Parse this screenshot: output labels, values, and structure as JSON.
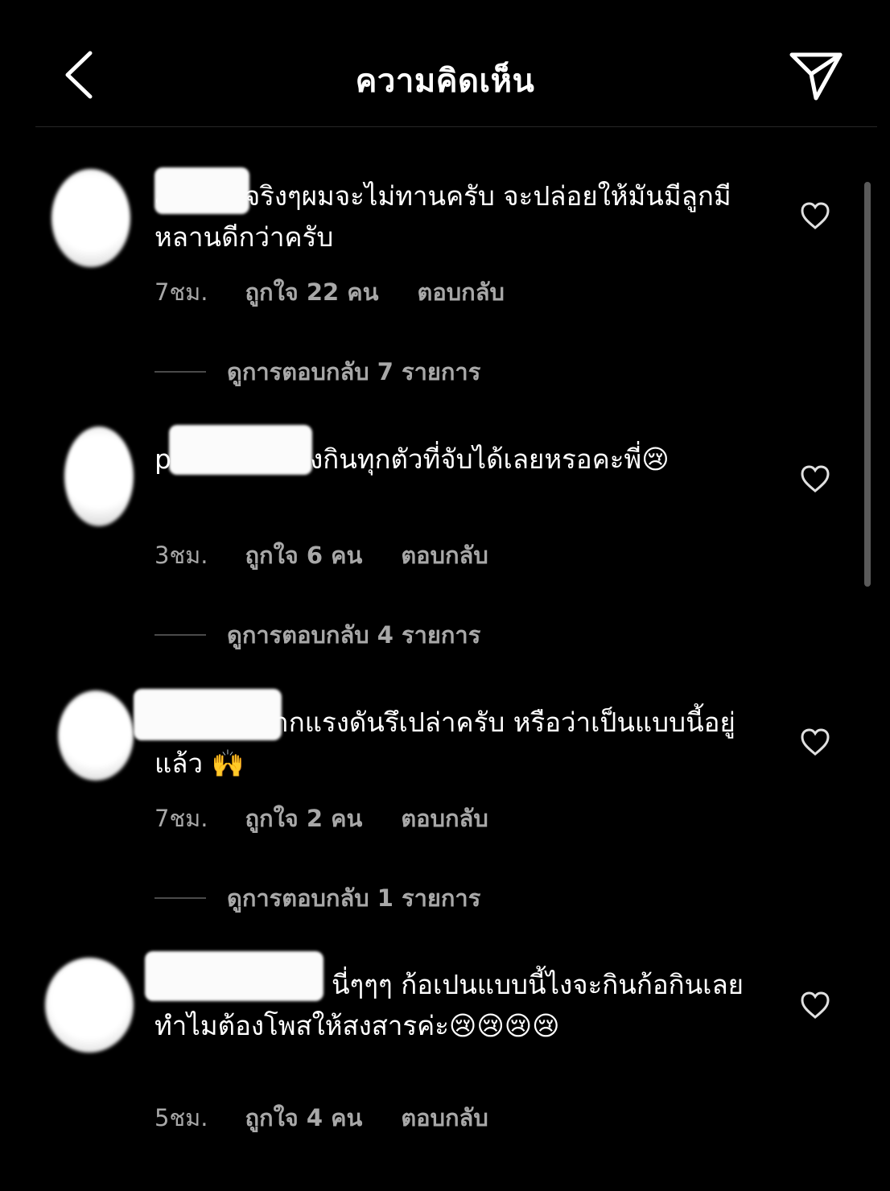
{
  "header": {
    "title": "ความคิดเห็น",
    "back_icon": "chevron-left-icon",
    "share_icon": "paper-plane-icon"
  },
  "colors": {
    "background": "#000000",
    "text": "#ffffff",
    "muted": "#a8a8a8",
    "divider": "#262626"
  },
  "comments": [
    {
      "text": "a 1 เอาจริงๆผมจะไม่ทานครับ จะปล่อยให้มันมีลูกมีหลานดีกว่าครับ",
      "time": "7ชม.",
      "likes": "ถูกใจ 22 คน",
      "reply": "ตอบกลับ",
      "view_replies": "ดูการตอบกลับ 7 รายการ"
    },
    {
      "text": "p z จำเป็นต้องกินทุกตัวที่จับได้เลยหรอคะพี่😢",
      "time": "3ชม.",
      "likes": "ถูกใจ 6 คน",
      "reply": "ตอบกลับ",
      "view_replies": "ดูการตอบกลับ 4 รายการ"
    },
    {
      "text": "s ตาบวมจากแรงดันรึเปล่าครับ หรือว่าเป็นแบบนี้อยู่แล้ว 🙌",
      "time": "7ชม.",
      "likes": "ถูกใจ 2 คน",
      "reply": "ตอบกลับ",
      "view_replies": "ดูการตอบกลับ 1 รายการ"
    },
    {
      "text": "นี่ๆๆๆ ก้อเปนแบบนี้ไงจะกินก้อกินเลยทำไมต้องโพสให้สงสารค่ะ😢😢😢😢",
      "time": "5ชม.",
      "likes": "ถูกใจ 4 คน",
      "reply": "ตอบกลับ"
    }
  ]
}
